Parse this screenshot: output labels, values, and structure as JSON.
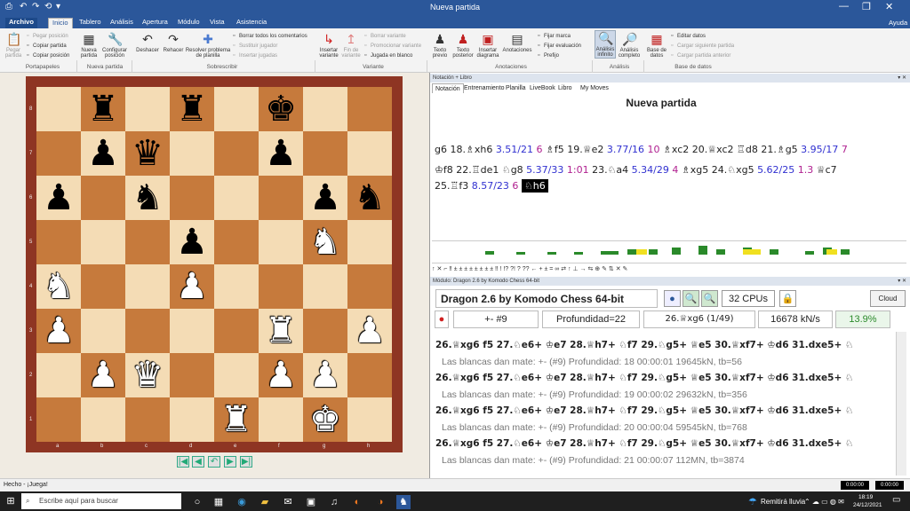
{
  "window": {
    "title": "Nueva partida",
    "help": "Ayuda"
  },
  "quick_access": [
    "⎙",
    "↶",
    "↷",
    "⟲",
    "▾"
  ],
  "window_controls": [
    "—",
    "❐",
    "✕"
  ],
  "tabs": [
    {
      "label": "Archivo"
    },
    {
      "label": "Inicio"
    },
    {
      "label": "Tablero"
    },
    {
      "label": "Análisis"
    },
    {
      "label": "Apertura"
    },
    {
      "label": "Módulo"
    },
    {
      "label": "Vista"
    },
    {
      "label": "Asistencia"
    }
  ],
  "ribbon": {
    "groups": [
      "Portapapeles",
      "Nueva partida",
      "Sobrescribir",
      "Variante",
      "Anotaciones",
      "Análisis",
      "Base de datos"
    ],
    "clipboard": {
      "paste": "Pegar partida",
      "paste_pos": "Pegar posición",
      "copy_game": "Copiar partida",
      "copy_pos": "Copiar posición"
    },
    "new_game": {
      "new": "Nueva partida",
      "config": "Configurar posición"
    },
    "overwrite": {
      "undo": "Deshacer",
      "redo": "Rehacer",
      "solve": "Resolver problema de planilla",
      "delete_comments": "Borrar todos los comentarios",
      "replace_player": "Sustituir jugador",
      "insert_moves": "Insertar jugadas"
    },
    "variant": {
      "insert": "Insertar variante",
      "end": "Fin de variante",
      "delete": "Borrar variante",
      "promote": "Promocionar variante",
      "blank": "Jugada en blanco"
    },
    "annotations": {
      "text_before": "Texto previo",
      "text_after": "Texto posterior",
      "insert_diagram": "Insertar diagrama",
      "annotations": "Anotaciones",
      "fix_mark": "Fijar marca",
      "fix_eval": "Fijar evaluación",
      "prefix": "Prefijo"
    },
    "analysis": {
      "infinite": "Análisis infinito",
      "full": "Análisis completo"
    },
    "database": {
      "base": "Base de datos",
      "edit": "Editar datos",
      "load_next": "Cargar siguiente partida",
      "load_prev": "Cargar partida anterior"
    }
  },
  "board": {
    "files": [
      "a",
      "b",
      "c",
      "d",
      "e",
      "f",
      "g",
      "h"
    ],
    "ranks": [
      "8",
      "7",
      "6",
      "5",
      "4",
      "3",
      "2",
      "1"
    ],
    "pieces": [
      {
        "sq": "b8",
        "p": "♜",
        "c": "b"
      },
      {
        "sq": "d8",
        "p": "♜",
        "c": "b"
      },
      {
        "sq": "f8",
        "p": "♚",
        "c": "b"
      },
      {
        "sq": "b7",
        "p": "♟",
        "c": "b"
      },
      {
        "sq": "c7",
        "p": "♛",
        "c": "b"
      },
      {
        "sq": "f7",
        "p": "♟",
        "c": "b"
      },
      {
        "sq": "a6",
        "p": "♟",
        "c": "b"
      },
      {
        "sq": "c6",
        "p": "♞",
        "c": "b"
      },
      {
        "sq": "g6",
        "p": "♟",
        "c": "b"
      },
      {
        "sq": "h6",
        "p": "♞",
        "c": "b"
      },
      {
        "sq": "d5",
        "p": "♟",
        "c": "b"
      },
      {
        "sq": "g5",
        "p": "♞",
        "c": "w"
      },
      {
        "sq": "a4",
        "p": "♞",
        "c": "w"
      },
      {
        "sq": "d4",
        "p": "♟",
        "c": "w"
      },
      {
        "sq": "a3",
        "p": "♟",
        "c": "w"
      },
      {
        "sq": "f3",
        "p": "♜",
        "c": "w"
      },
      {
        "sq": "h3",
        "p": "♟",
        "c": "w"
      },
      {
        "sq": "b2",
        "p": "♟",
        "c": "w"
      },
      {
        "sq": "c2",
        "p": "♛",
        "c": "w"
      },
      {
        "sq": "f2",
        "p": "♟",
        "c": "w"
      },
      {
        "sq": "g2",
        "p": "♟",
        "c": "w"
      },
      {
        "sq": "e1",
        "p": "♜",
        "c": "w"
      },
      {
        "sq": "g1",
        "p": "♚",
        "c": "w"
      }
    ]
  },
  "nav_buttons": [
    "|◀",
    "◀",
    "↶",
    "▶",
    "▶|"
  ],
  "notation": {
    "header": "Notación + Libro",
    "tabs": [
      "Notación",
      "Entrenamiento",
      "Planilla",
      "LiveBook",
      "Libro",
      "My Moves"
    ],
    "game_title": "Nueva partida",
    "lines": [
      [
        {
          "t": "g6  18.♗xh6 ",
          "k": ""
        },
        {
          "t": "3.51/21",
          "k": "ev"
        },
        {
          "t": " 6",
          "k": "tm"
        },
        {
          "t": "  ♗f5  19.♕e2 ",
          "k": ""
        },
        {
          "t": "3.77/16",
          "k": "ev"
        },
        {
          "t": " 10",
          "k": "tm"
        },
        {
          "t": "  ♗xc2  20.♕xc2  ♖d8  21.♗g5 ",
          "k": ""
        },
        {
          "t": "3.95/17",
          "k": "ev"
        },
        {
          "t": " 7",
          "k": "tm"
        }
      ],
      [
        {
          "t": "♔f8  22.♖de1  ♘g8 ",
          "k": ""
        },
        {
          "t": "5.37/33",
          "k": "ev"
        },
        {
          "t": " 1:01",
          "k": "tm"
        },
        {
          "t": "  23.♘a4 ",
          "k": ""
        },
        {
          "t": "5.34/29",
          "k": "ev"
        },
        {
          "t": " 4",
          "k": "tm"
        },
        {
          "t": "  ♗xg5  24.♘xg5 ",
          "k": ""
        },
        {
          "t": "5.62/25",
          "k": "ev"
        },
        {
          "t": " 1.3",
          "k": "tm"
        },
        {
          "t": "  ♕c7",
          "k": ""
        }
      ],
      [
        {
          "t": "25.♖f3 ",
          "k": ""
        },
        {
          "t": "8.57/23",
          "k": "ev"
        },
        {
          "t": " 6",
          "k": "tm"
        },
        {
          "t": "  ",
          "k": ""
        },
        {
          "t": "♘h6",
          "k": "cur"
        }
      ]
    ]
  },
  "symbols": "↑  ✕  ⌐  ‼  ±  ±  ±  ±  ±  ±  ±  ±  ‼  !  !?  ?!  ?  ??  ←  +  ±  =  ∞  ⇄  ↑  ⊥  →  ⇆  ⊕  ✎  ⇅  ✕  ✎",
  "engine": {
    "header": "Módulo: Dragon 2.6 by Komodo Chess 64-bit",
    "name": "Dragon 2.6 by Komodo Chess 64-bit",
    "cpus": "32 CPUs",
    "cloud": "Cloud",
    "eval": "+- #9",
    "depth": "Profundidad=22",
    "move": "26.♕xg6 (1/49)",
    "speed": "16678 kN/s",
    "pct": "13.9%",
    "lines": [
      {
        "pv": "26.♕xg6 f5 27.♘e6+ ♔e7 28.♕h7+ ♘f7 29.♘g5+ ♕e5 30.♕xf7+ ♔d6 31.dxe5+ ♘",
        "info": "Las blancas dan mate: +- (#9)  Profundidad: 18   00:00:01  19645kN, tb=56"
      },
      {
        "pv": "26.♕xg6 f5 27.♘e6+ ♔e7 28.♕h7+ ♘f7 29.♘g5+ ♕e5 30.♕xf7+ ♔d6 31.dxe5+ ♘",
        "info": "Las blancas dan mate: +- (#9)  Profundidad: 19   00:00:02  29632kN, tb=356"
      },
      {
        "pv": "26.♕xg6 f5 27.♘e6+ ♔e7 28.♕h7+ ♘f7 29.♘g5+ ♕e5 30.♕xf7+ ♔d6 31.dxe5+ ♘",
        "info": "Las blancas dan mate: +- (#9)  Profundidad: 20   00:00:04  59545kN, tb=768"
      },
      {
        "pv": "26.♕xg6 f5 27.♘e6+ ♔e7 28.♕h7+ ♘f7 29.♘g5+ ♕e5 30.♕xf7+ ♔d6 31.dxe5+ ♘",
        "info": "Las blancas dan mate: +- (#9)  Profundidad: 21   00:00:07  112MN, tb=3874"
      }
    ]
  },
  "status": {
    "left": "Hecho - ¡Juega!",
    "clock1": "0:00:00",
    "clock2": "0:00:00"
  },
  "taskbar": {
    "search": "Escribe aquí para buscar",
    "weather": "Remitirá lluvia",
    "time": "18:19",
    "date": "24/12/2021"
  },
  "colors": {
    "title_blue": "#2b579a",
    "light_square": "#f4dcb5",
    "dark_square": "#c67a3c",
    "eval_green": "#2a8a2a"
  }
}
